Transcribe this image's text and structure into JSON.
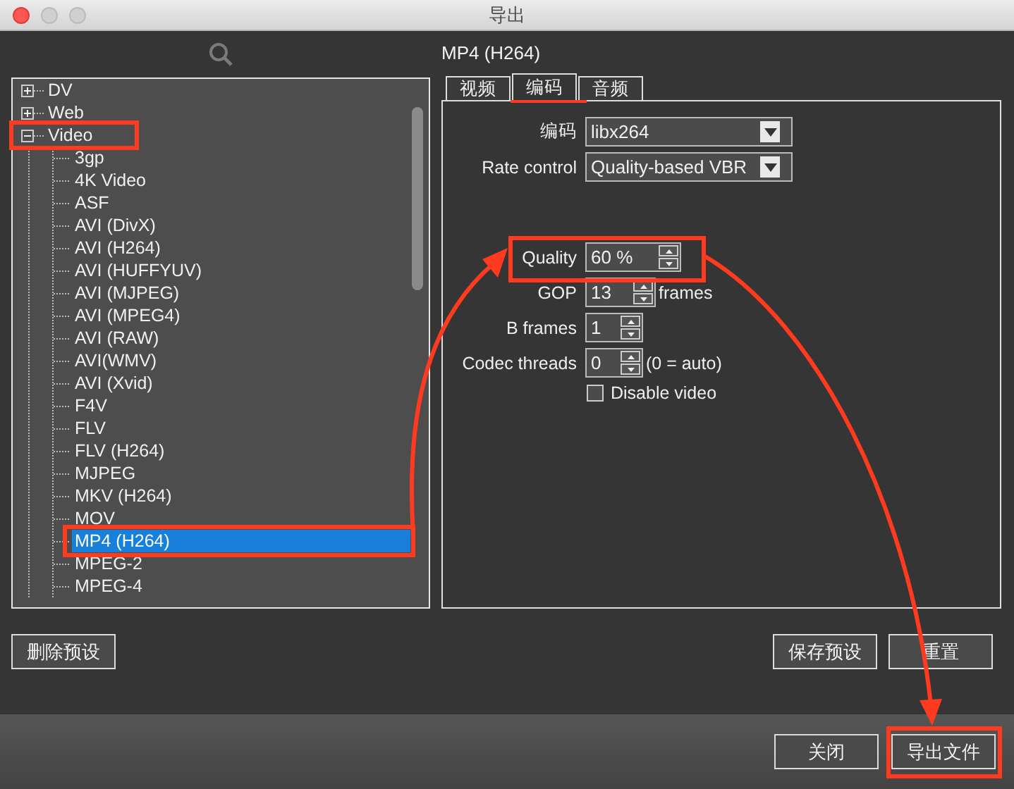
{
  "window": {
    "title": "导出"
  },
  "tree": [
    {
      "label": "DV",
      "expanded": false,
      "selected": false
    },
    {
      "label": "Web",
      "expanded": false,
      "selected": false
    },
    {
      "label": "Video",
      "expanded": true,
      "selected": false,
      "children": [
        {
          "label": "3gp",
          "selected": false
        },
        {
          "label": "4K Video",
          "selected": false
        },
        {
          "label": "ASF",
          "selected": false
        },
        {
          "label": "AVI (DivX)",
          "selected": false
        },
        {
          "label": "AVI (H264)",
          "selected": false
        },
        {
          "label": "AVI (HUFFYUV)",
          "selected": false
        },
        {
          "label": "AVI (MJPEG)",
          "selected": false
        },
        {
          "label": "AVI (MPEG4)",
          "selected": false
        },
        {
          "label": "AVI (RAW)",
          "selected": false
        },
        {
          "label": "AVI(WMV)",
          "selected": false
        },
        {
          "label": "AVI (Xvid)",
          "selected": false
        },
        {
          "label": "F4V",
          "selected": false
        },
        {
          "label": "FLV",
          "selected": false
        },
        {
          "label": "FLV (H264)",
          "selected": false
        },
        {
          "label": "MJPEG",
          "selected": false
        },
        {
          "label": "MKV (H264)",
          "selected": false
        },
        {
          "label": "MOV",
          "selected": false
        },
        {
          "label": "MP4 (H264)",
          "selected": true
        },
        {
          "label": "MPEG-2",
          "selected": false
        },
        {
          "label": "MPEG-4",
          "selected": false
        }
      ]
    }
  ],
  "preset_title": "MP4 (H264)",
  "tabs": [
    {
      "label": "视频",
      "selected": false
    },
    {
      "label": "编码",
      "selected": true
    },
    {
      "label": "音频",
      "selected": false
    }
  ],
  "setting_groups": [
    [
      {
        "kind": "select",
        "label": "编码",
        "value": "libx264"
      },
      {
        "kind": "select",
        "label": "Rate control",
        "value": "Quality-based VBR"
      }
    ],
    [
      {
        "kind": "spin",
        "label": "Quality",
        "value": "60 %"
      },
      {
        "kind": "spin",
        "label": "GOP",
        "value": "13",
        "suffix": "frames"
      },
      {
        "kind": "spin",
        "label": "B frames",
        "value": "1"
      },
      {
        "kind": "spin",
        "label": "Codec threads",
        "value": "0",
        "suffix": "(0 = auto)"
      },
      {
        "kind": "checkbox",
        "label": "Disable video",
        "checked": false
      }
    ]
  ],
  "preset_buttons": {
    "left": [
      "删除预设"
    ],
    "right": [
      "保存预设",
      "重置"
    ]
  },
  "dialog_buttons": [
    "关闭",
    "导出文件"
  ]
}
